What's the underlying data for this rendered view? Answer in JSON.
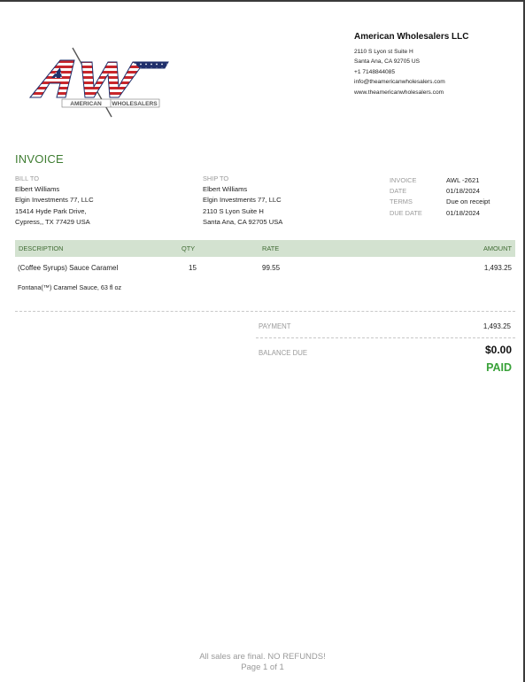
{
  "company": {
    "name": "American Wholesalers LLC",
    "address1": "2110 S Lyon st Suite H",
    "address2": "Santa Ana, CA  92705 US",
    "phone": "+1 7148844085",
    "email": "info@theamericanwholesalers.com",
    "website": "www.theamericanwholesalers.com"
  },
  "logo": {
    "letters": "AW",
    "caption_left": "AMERICAN",
    "caption_right": "WHOLESALERS",
    "colors": {
      "red": "#c8262b",
      "blue": "#1f2f6b",
      "white": "#ffffff"
    }
  },
  "invoice": {
    "title": "INVOICE",
    "bill_to_label": "BILL TO",
    "bill_to": [
      "Elbert Williams",
      "Elgin Investments 77, LLC",
      "15414 Hyde Park Drive,",
      "Cypress,, TX  77429 USA"
    ],
    "ship_to_label": "SHIP TO",
    "ship_to": [
      "Elbert Williams",
      "Elgin Investments 77, LLC",
      "2110 S Lyon Suite H",
      "Santa Ana, CA  92705 USA"
    ],
    "meta": [
      {
        "key": "INVOICE",
        "value": "AWL -2621"
      },
      {
        "key": "DATE",
        "value": "01/18/2024"
      },
      {
        "key": "TERMS",
        "value": "Due on receipt"
      },
      {
        "key": "DUE DATE",
        "value": "01/18/2024"
      }
    ]
  },
  "table": {
    "headers": {
      "description": "DESCRIPTION",
      "qty": "QTY",
      "rate": "RATE",
      "amount": "AMOUNT"
    },
    "rows": [
      {
        "description": "(Coffee Syrups) Sauce Caramel",
        "detail": "Fontana(™) Caramel Sauce, 63 fl oz",
        "qty": "15",
        "rate": "99.55",
        "amount": "1,493.25"
      }
    ]
  },
  "summary": {
    "payment_label": "PAYMENT",
    "payment_value": "1,493.25",
    "balance_label": "BALANCE DUE",
    "balance_value": "$0.00",
    "status": "PAID"
  },
  "footer": {
    "note": "All sales are final. NO REFUNDS!",
    "page": "Page 1 of 1"
  }
}
